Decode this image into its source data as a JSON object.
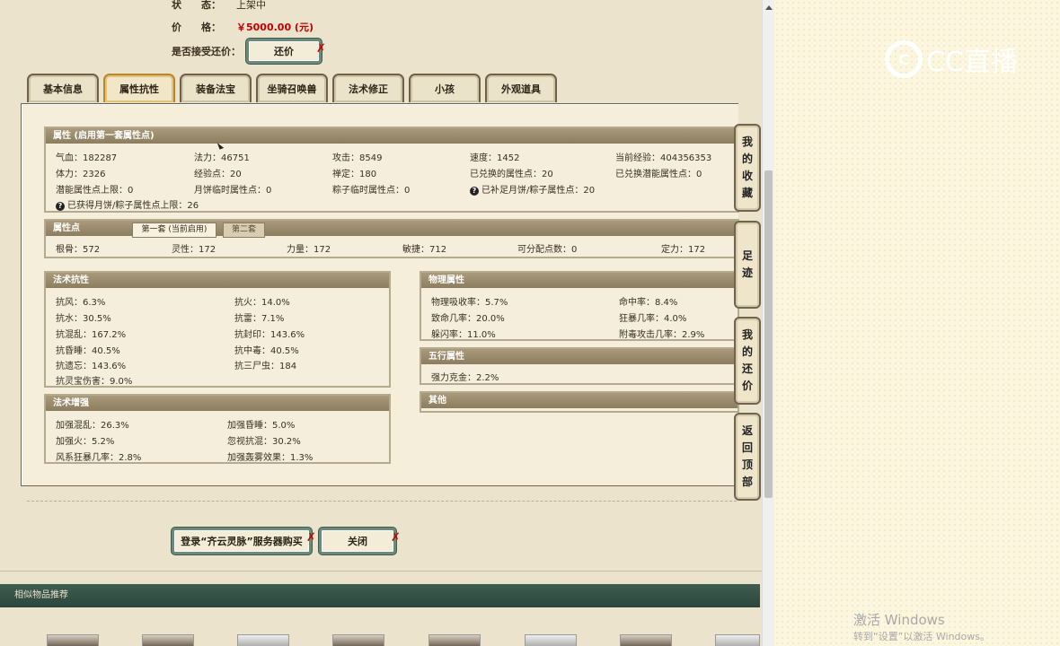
{
  "info": {
    "status_label": "状　　态：",
    "status_value": "上架中",
    "price_label": "价　　格：",
    "price_value": "￥5000.00 (元)",
    "counter_offer_label": "是否接受还价：",
    "counter_offer_button": "还价",
    "x_mark": "✗"
  },
  "tabs": [
    {
      "label": "基本信息"
    },
    {
      "label": "属性抗性"
    },
    {
      "label": "装备法宝"
    },
    {
      "label": "坐骑召唤兽"
    },
    {
      "label": "法术修正"
    },
    {
      "label": "小孩"
    },
    {
      "label": "外观道具"
    }
  ],
  "attributes": {
    "title": "属性 (启用第一套属性点)",
    "row1": [
      "气血：182287",
      "法力：46751",
      "攻击：8549",
      "速度：1452",
      "当前经验：404356353"
    ],
    "row2": [
      "体力：2326",
      "经验点：20",
      "禅定：180",
      "已兑换的属性点：20",
      "已兑换潜能属性点：0"
    ],
    "row3": [
      "潜能属性点上限：0",
      "月饼临时属性点：0",
      "粽子临时属性点：0",
      "已补足月饼/粽子属性点：20"
    ],
    "row4": "已获得月饼/粽子属性点上限：26",
    "question_icon": "?"
  },
  "points": {
    "title": "属性点",
    "subtab1": "第一套 (当前启用)",
    "subtab2": "第二套",
    "values": [
      "根骨：572",
      "灵性：172",
      "力量：172",
      "敏捷：712",
      "可分配点数：0",
      "定力：172"
    ]
  },
  "magic_resist": {
    "title": "法术抗性",
    "left": [
      "抗风：6.3%",
      "抗水：30.5%",
      "抗混乱：167.2%",
      "抗昏睡：40.5%",
      "抗遗忘：143.6%",
      "抗灵宝伤害：9.0%"
    ],
    "right": [
      "抗火：14.0%",
      "抗雷：7.1%",
      "抗封印：143.6%",
      "抗中毒：40.5%",
      "抗三尸虫：184"
    ]
  },
  "magic_boost": {
    "title": "法术增强",
    "left": [
      "加强混乱：26.3%",
      "加强火：5.2%",
      "风系狂暴几率：2.8%"
    ],
    "right": [
      "加强昏睡：5.0%",
      "忽视抗混：30.2%",
      "加强轰雾效果：1.3%"
    ]
  },
  "physical": {
    "title": "物理属性",
    "left": [
      "物理吸收率：5.7%",
      "致命几率：20.0%",
      "躲闪率：11.0%"
    ],
    "right": [
      "命中率：8.4%",
      "狂暴几率：4.0%",
      "附毒攻击几率：2.9%"
    ]
  },
  "five_elements": {
    "title": "五行属性",
    "values": [
      "强力克金：2.2%"
    ]
  },
  "other": {
    "title": "其他"
  },
  "side_buttons": [
    {
      "chars": [
        "我",
        "的",
        "收",
        "藏"
      ]
    },
    {
      "chars": [
        "足",
        "迹"
      ]
    },
    {
      "chars": [
        "我",
        "的",
        "还",
        "价"
      ]
    },
    {
      "chars": [
        "返",
        "回",
        "顶",
        "部"
      ]
    }
  ],
  "bottom": {
    "login_button": "登录“齐云灵脉”服务器购买",
    "close_button": "关闭",
    "recommend_title": "相似物品推荐"
  },
  "overlay": {
    "logo_text": "CC直播",
    "watermark_title": "激活 Windows",
    "watermark_sub": "转到“设置”以激活 Windows。"
  },
  "colors": {
    "accent_price": "#c00000",
    "recommend_bar": "#2c463c",
    "active_tab_border": "#b8862e"
  },
  "icons": [
    "question-icon",
    "cursor-icon",
    "scroll-up-icon",
    "cc-logo-icon",
    "close-x-icon"
  ]
}
